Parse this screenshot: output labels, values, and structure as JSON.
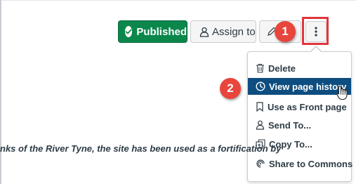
{
  "toolbar": {
    "published_label": "Published",
    "assign_label": "Assign to",
    "edit_icon": "pencil-icon",
    "more_icon": "vertical-ellipsis-icon"
  },
  "callouts": {
    "step1": "1",
    "step2": "2"
  },
  "menu": {
    "items": [
      {
        "label": "Delete",
        "icon": "trash-icon"
      },
      {
        "label": "View page history",
        "icon": "clock-icon",
        "active": true
      },
      {
        "label": "Use as Front page",
        "icon": "bookmark-icon"
      },
      {
        "label": "Send To...",
        "icon": "user-icon"
      },
      {
        "label": "Copy To...",
        "icon": "copy-icon"
      },
      {
        "label": "Share to Commons",
        "icon": "commons-icon"
      }
    ]
  },
  "content": {
    "paragraph_fragment": "nks of the River Tyne, the site has been used as a fortification by"
  },
  "colors": {
    "published_green": "#0b874b",
    "menu_highlight": "#0e4d7f",
    "callout_red": "#e8453c",
    "highlight_border": "#e0363c"
  }
}
